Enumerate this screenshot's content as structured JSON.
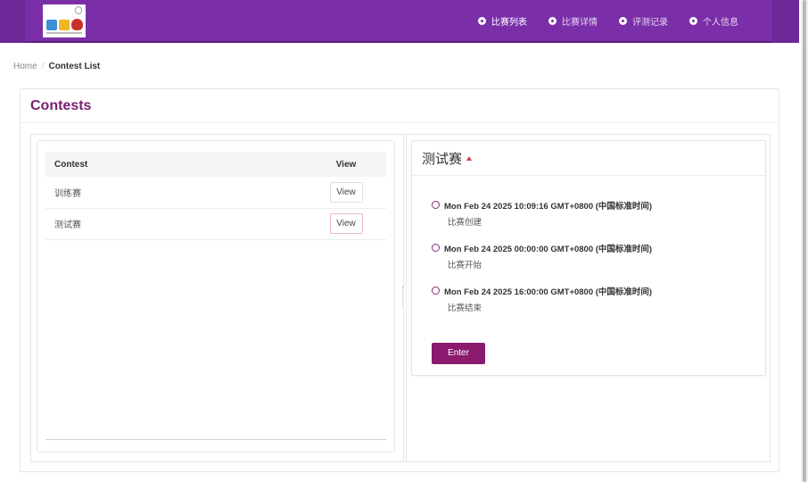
{
  "nav": {
    "items": [
      {
        "label": "比赛列表",
        "icon": "circle-dot-icon",
        "active": true
      },
      {
        "label": "比赛详情",
        "icon": "circle-dot-icon",
        "active": false
      },
      {
        "label": "评测记录",
        "icon": "circle-dot-icon",
        "active": false
      },
      {
        "label": "个人信息",
        "icon": "circle-dot-icon",
        "active": false
      }
    ]
  },
  "breadcrumb": {
    "home": "Home",
    "separator": "/",
    "current": "Contest List"
  },
  "card": {
    "title": "Contests"
  },
  "table": {
    "headers": {
      "contest": "Contest",
      "view": "View"
    },
    "rows": [
      {
        "name": "训练赛",
        "action": "View"
      },
      {
        "name": "测试赛",
        "action": "View"
      }
    ]
  },
  "detail": {
    "title": "测试赛",
    "timeline": [
      {
        "time": "Mon Feb 24 2025 10:09:16 GMT+0800 (中国标准时间)",
        "label": "比赛创建"
      },
      {
        "time": "Mon Feb 24 2025 00:00:00 GMT+0800 (中国标准时间)",
        "label": "比赛开始"
      },
      {
        "time": "Mon Feb 24 2025 16:00:00 GMT+0800 (中国标准时间)",
        "label": "比赛结束"
      }
    ],
    "enter_label": "Enter"
  },
  "colors": {
    "topbar": "#7a2fa8",
    "accent": "#8c1a6e",
    "title": "#7a1f6e"
  }
}
